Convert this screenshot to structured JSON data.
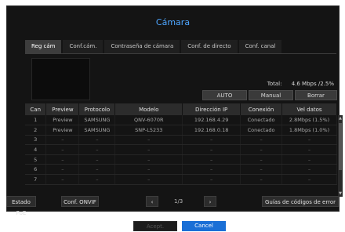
{
  "title": "Cámara",
  "tabs": [
    {
      "label": "Reg cám",
      "active": true
    },
    {
      "label": "Conf.cám.",
      "active": false
    },
    {
      "label": "Contraseña de cámara",
      "active": false
    },
    {
      "label": "Conf. de directo",
      "active": false
    },
    {
      "label": "Conf. canal",
      "active": false
    }
  ],
  "total": {
    "label": "Total:",
    "value": "4.6  Mbps /2.5%"
  },
  "actions": {
    "auto": "AUTO",
    "manual": "Manual",
    "delete": "Borrar"
  },
  "table": {
    "headers": [
      "Can",
      "Preview",
      "Protocolo",
      "Modelo",
      "Dirección IP",
      "Conexión",
      "Vel datos"
    ],
    "rows": [
      [
        "1",
        "Preview",
        "SAMSUNG",
        "QNV-6070R",
        "192.168.4.29",
        "Conectado",
        "2.8Mbps (1.5%)"
      ],
      [
        "2",
        "Preview",
        "SAMSUNG",
        "SNP-L5233",
        "192.168.0.18",
        "Conectado",
        "1.8Mbps (1.0%)"
      ],
      [
        "3",
        "–",
        "–",
        "–",
        "–",
        "–",
        "–"
      ],
      [
        "4",
        "–",
        "–",
        "–",
        "–",
        "–",
        "–"
      ],
      [
        "5",
        "–",
        "–",
        "–",
        "–",
        "–",
        "–"
      ],
      [
        "6",
        "–",
        "–",
        "–",
        "–",
        "–",
        "–"
      ],
      [
        "7",
        "–",
        "–",
        "–",
        "–",
        "–",
        "–"
      ]
    ]
  },
  "bottom": {
    "poe_status": "Estado PoE",
    "onvif_conf": "Conf. ONVIF",
    "page": "1/3",
    "error_guide": "Guías de códigos de error"
  },
  "footer": {
    "accept": "Acept.",
    "cancel": "Cancel"
  },
  "colors": {
    "accent": "#4ea6ff",
    "primary_button": "#1a6fd6",
    "background": "#141414"
  }
}
